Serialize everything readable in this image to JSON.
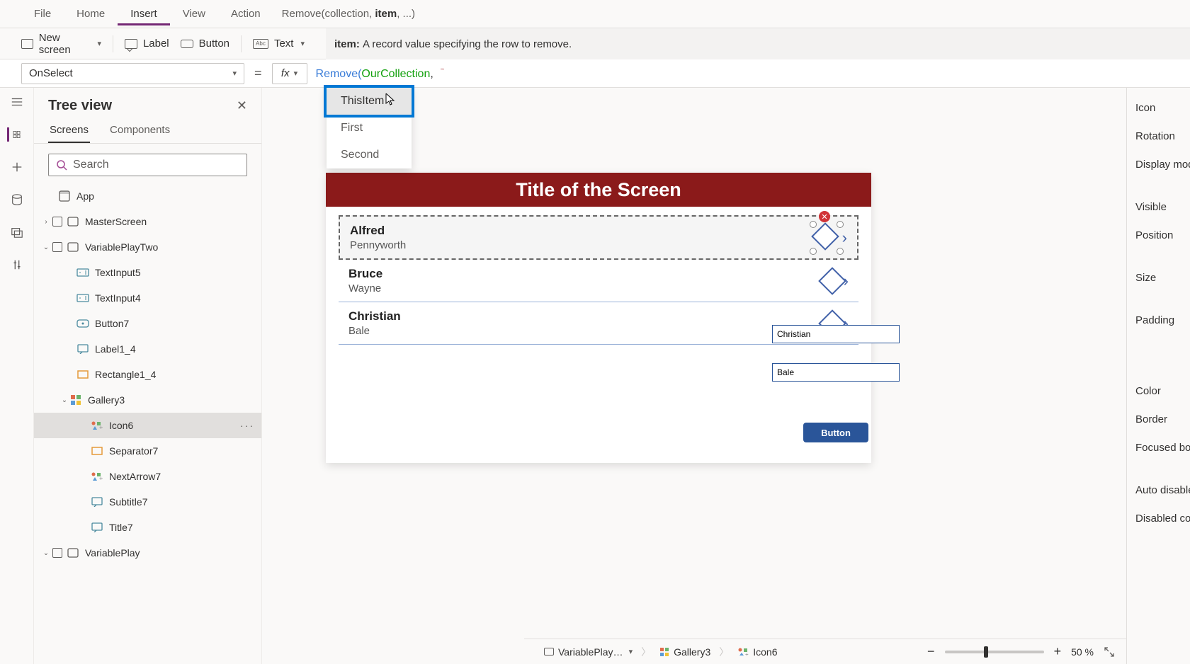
{
  "top_menu": {
    "items": [
      "File",
      "Home",
      "Insert",
      "View",
      "Action"
    ],
    "active": "Insert"
  },
  "ribbon": {
    "new_screen": "New screen",
    "label": "Label",
    "button": "Button",
    "text": "Text"
  },
  "signature": {
    "parts": [
      "Remove(collection, ",
      "item",
      ", ...)"
    ]
  },
  "item_hint": {
    "label": "item:",
    "desc": "A record value specifying the row to remove."
  },
  "formula": {
    "property": "OnSelect",
    "tokens": {
      "fn": "Remove",
      "paren": "(",
      "ident": "OurCollection",
      "comma": ","
    }
  },
  "autocomplete": {
    "items": [
      "ThisItem",
      "First",
      "Second"
    ],
    "selected_index": 0
  },
  "tree": {
    "title": "Tree view",
    "tabs": [
      "Screens",
      "Components"
    ],
    "active_tab": "Screens",
    "search_placeholder": "Search",
    "items": [
      {
        "label": "App",
        "indent": 20,
        "icon": "app"
      },
      {
        "label": "MasterScreen",
        "indent": 10,
        "toggle": ">",
        "checkbox": true,
        "icon": "screen"
      },
      {
        "label": "VariablePlayTwo",
        "indent": 10,
        "toggle": "v",
        "checkbox": true,
        "icon": "screen"
      },
      {
        "label": "TextInput5",
        "indent": 46,
        "icon": "textinput"
      },
      {
        "label": "TextInput4",
        "indent": 46,
        "icon": "textinput"
      },
      {
        "label": "Button7",
        "indent": 46,
        "icon": "button"
      },
      {
        "label": "Label1_4",
        "indent": 46,
        "icon": "label"
      },
      {
        "label": "Rectangle1_4",
        "indent": 46,
        "icon": "rect"
      },
      {
        "label": "Gallery3",
        "indent": 36,
        "toggle": "v",
        "icon": "gallery"
      },
      {
        "label": "Icon6",
        "indent": 66,
        "icon": "icon",
        "selected": true,
        "more": true
      },
      {
        "label": "Separator7",
        "indent": 66,
        "icon": "rect"
      },
      {
        "label": "NextArrow7",
        "indent": 66,
        "icon": "icon"
      },
      {
        "label": "Subtitle7",
        "indent": 66,
        "icon": "label"
      },
      {
        "label": "Title7",
        "indent": 66,
        "icon": "label"
      },
      {
        "label": "VariablePlay",
        "indent": 10,
        "toggle": "v",
        "checkbox": true,
        "icon": "screen"
      }
    ]
  },
  "canvas": {
    "screen_title": "Title of the Screen",
    "gallery": [
      {
        "first": "Alfred",
        "last": "Pennyworth"
      },
      {
        "first": "Bruce",
        "last": "Wayne"
      },
      {
        "first": "Christian",
        "last": "Bale"
      }
    ],
    "input1": "Christian",
    "input2": "Bale",
    "button_label": "Button"
  },
  "props": {
    "rows": [
      "Icon",
      "Rotation",
      "Display mod",
      "",
      "Visible",
      "Position",
      "",
      "Size",
      "",
      "Padding",
      "",
      "",
      "",
      "Color",
      "Border",
      "Focused bor",
      "",
      "Auto disable",
      "Disabled col"
    ]
  },
  "status": {
    "crumbs": [
      "VariablePlay…",
      "Gallery3",
      "Icon6"
    ],
    "zoom": "50",
    "zoom_unit": "%"
  }
}
